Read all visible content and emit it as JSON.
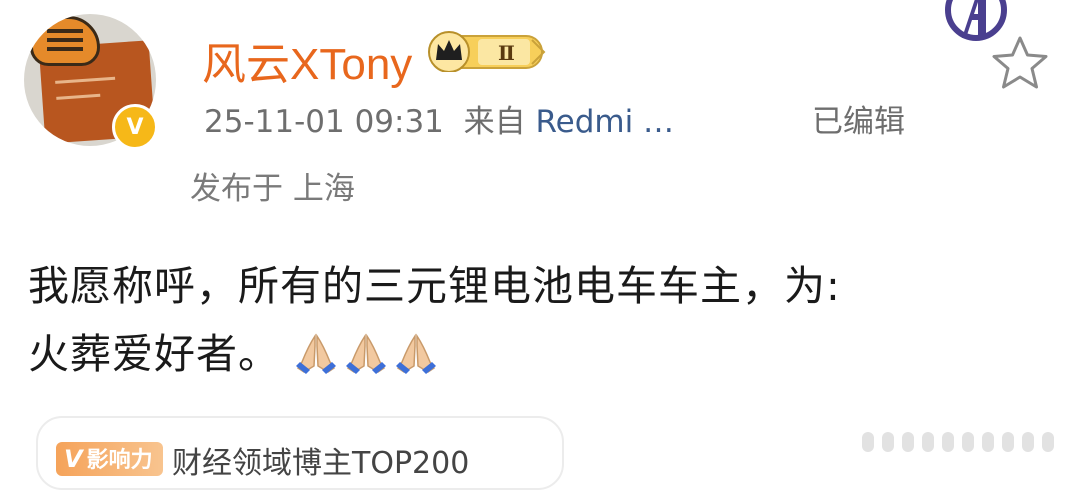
{
  "post": {
    "username": "风云XTony",
    "vip_level": "Ⅱ",
    "timestamp": "25-11-01 09:31",
    "source_prefix": "来自",
    "source_device": "Redmi …",
    "edited_label": "已编辑",
    "location": "发布于 上海",
    "content_line1": "我愿称呼，所有的三元锂电池电车车主，为:",
    "content_line2": "火葬爱好者。",
    "emojis": [
      "pray-hands",
      "pray-hands",
      "pray-hands"
    ],
    "verified_mark": "V"
  },
  "influence": {
    "tag_v": "V",
    "tag_label": "影响力",
    "text": "财经领域博主TOP200"
  },
  "colors": {
    "username": "#e8671d",
    "meta": "#6e6e6e",
    "device": "#3a5b8c",
    "badge_gold": "#f6b818"
  },
  "icons": {
    "avengers": "avengers-icon",
    "favorite": "star-icon"
  }
}
